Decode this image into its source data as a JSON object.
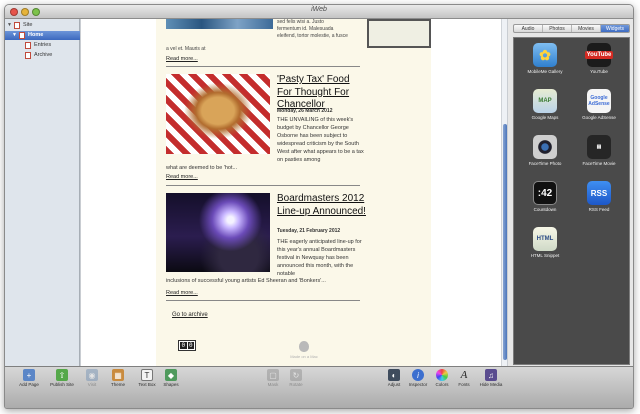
{
  "window": {
    "title": "iWeb"
  },
  "sidebar": {
    "site": "Site",
    "items": [
      {
        "label": "Home",
        "selected": true
      },
      {
        "label": "Entries"
      },
      {
        "label": "Archive"
      }
    ]
  },
  "page": {
    "fragment_left": "a vel et. Mauris at",
    "fragment_right": [
      "sed felis wisi a. Justo",
      "fermentum id. Malesuada",
      "eleifend, tortor molestie, a fusce"
    ],
    "readmore": "Read more...",
    "articles": [
      {
        "title": "'Pasty Tax' Food For Thought For Chancellor",
        "date": "Monday, 26 March 2012",
        "text": "THE UNVAILING of this week's budget by Chancellor George Osborne has been subject to widespread criticism by the South West after what appears to be a tax on pasties among",
        "text_full": "what are deemed to be 'hot...",
        "image": "pasty-photo"
      },
      {
        "title": "Boardmasters 2012 Line-up Announced!",
        "date": "Tuesday, 21 February 2012",
        "text": "THE eagerly anticipated line-up for this year's annual Boardmasters festival in Newquay has been announced this month, with the notable",
        "text_full": "inclusions of successful young artists Ed Sheeran and 'Bonkers'...",
        "image": "concert-photo"
      }
    ],
    "archive_link": "Go to archive",
    "counter": [
      "0",
      "0"
    ],
    "made_on": "Made on a Mac"
  },
  "media": {
    "tabs": [
      "Audio",
      "Photos",
      "Movies",
      "Widgets"
    ],
    "active_tab": "Widgets",
    "widgets": [
      {
        "label": "MobileMe Gallery",
        "icon": "gallery-icon",
        "glyph": "✿"
      },
      {
        "label": "YouTube",
        "icon": "youtube-icon",
        "glyph": "YouTube"
      },
      {
        "label": "Google Maps",
        "icon": "maps-icon",
        "glyph": "MAP"
      },
      {
        "label": "Google AdSense",
        "icon": "adsense-icon",
        "glyph": "Google AdSense"
      },
      {
        "label": "FaceTime Photo",
        "icon": "facetime-icon",
        "glyph": ""
      },
      {
        "label": "FaceTime Movie",
        "icon": "movie-icon",
        "glyph": "▤"
      },
      {
        "label": "Countdown",
        "icon": "countdown-icon",
        "glyph": ":42"
      },
      {
        "label": "RSS Feed",
        "icon": "rss-icon",
        "glyph": "RSS"
      },
      {
        "label": "HTML Snippet",
        "icon": "html-icon",
        "glyph": "HTML"
      }
    ]
  },
  "toolbar": {
    "left": [
      {
        "label": "Add Page",
        "icon": "add-page-icon",
        "glyph": "+"
      },
      {
        "label": "Publish Site",
        "icon": "publish-icon",
        "glyph": "⇧"
      },
      {
        "label": "Visit",
        "icon": "visit-icon",
        "glyph": "◉",
        "disabled": true
      },
      {
        "label": "Theme",
        "icon": "theme-icon",
        "glyph": "▦"
      },
      {
        "label": "Text Box",
        "icon": "textbox-icon",
        "glyph": "T"
      },
      {
        "label": "Shapes",
        "icon": "shapes-icon",
        "glyph": "◆"
      }
    ],
    "center": [
      {
        "label": "Mask",
        "icon": "mask-icon",
        "glyph": "▢",
        "disabled": true
      },
      {
        "label": "Rotate",
        "icon": "rotate-icon",
        "glyph": "↻",
        "disabled": true
      }
    ],
    "right": [
      {
        "label": "Adjust",
        "icon": "adjust-icon",
        "glyph": "◐"
      },
      {
        "label": "Inspector",
        "icon": "inspector-icon",
        "glyph": "i"
      },
      {
        "label": "Colors",
        "icon": "colors-icon",
        "glyph": "●"
      },
      {
        "label": "Fonts",
        "icon": "fonts-icon",
        "glyph": "A"
      },
      {
        "label": "Hide Media",
        "icon": "media-icon",
        "glyph": "♫"
      }
    ]
  }
}
